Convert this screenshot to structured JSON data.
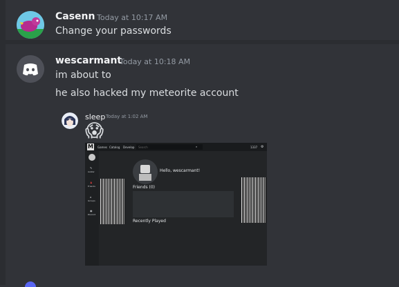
{
  "messages": [
    {
      "author": "Casenn",
      "timestamp": "Today at 10:17 AM",
      "lines": [
        "Change your passwords"
      ]
    },
    {
      "author": "wescarmant",
      "timestamp": "Today at 10:18 AM",
      "lines": [
        "im about to",
        "he also hacked my meteorite account"
      ]
    }
  ],
  "reply": {
    "author": "sleep",
    "timestamp": "Today at 1:02 AM",
    "emoji": "😱"
  },
  "screenshot": {
    "logo": "M",
    "nav": [
      "Games",
      "Catalog",
      "Develop"
    ],
    "search_placeholder": "Search",
    "balance": "1337",
    "sidebar": [
      "Avatar",
      "Friends",
      "Groups",
      "Discord"
    ],
    "greeting": "Hello, wescarmant!",
    "friends_label": "Friends (0)",
    "recent_label": "Recently Played"
  },
  "colors": {
    "background": "#313338",
    "text": "#dbdee1",
    "timestamp": "#949ba4"
  }
}
